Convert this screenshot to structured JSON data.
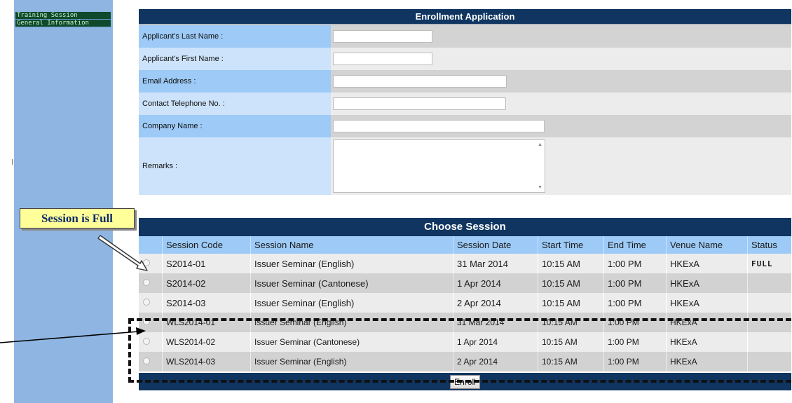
{
  "sidebar": {
    "items": [
      {
        "label": "Training Session"
      },
      {
        "label": "General Information"
      }
    ]
  },
  "form": {
    "title": "Enrollment Application",
    "fields": [
      {
        "label": "Applicant's Last Name :",
        "value": ""
      },
      {
        "label": "Applicant's First Name :",
        "value": ""
      },
      {
        "label": "Email Address :",
        "value": ""
      },
      {
        "label": "Contact Telephone No. :",
        "value": ""
      },
      {
        "label": "Company Name :",
        "value": ""
      },
      {
        "label": "Remarks :",
        "value": ""
      }
    ]
  },
  "session_table": {
    "title": "Choose Session",
    "headers": [
      "Session Code",
      "Session Name",
      "Session Date",
      "Start Time",
      "End Time",
      "Venue Name",
      "Status"
    ],
    "rows": [
      {
        "code": "S2014-01",
        "name": "Issuer Seminar (English)",
        "date": "31 Mar 2014",
        "start": "10:15 AM",
        "end": "1:00 PM",
        "venue": "HKExA",
        "status": "FULL"
      },
      {
        "code": "S2014-02",
        "name": "Issuer Seminar (Cantonese)",
        "date": "1 Apr 2014",
        "start": "10:15 AM",
        "end": "1:00 PM",
        "venue": "HKExA",
        "status": ""
      },
      {
        "code": "S2014-03",
        "name": "Issuer Seminar (English)",
        "date": "2 Apr 2014",
        "start": "10:15 AM",
        "end": "1:00 PM",
        "venue": "HKExA",
        "status": ""
      },
      {
        "code": "WLS2014-01",
        "name": "Issuer Seminar (English)",
        "date": "31 Mar 2014",
        "start": "10:15 AM",
        "end": "1:00 PM",
        "venue": "HKExA",
        "status": ""
      },
      {
        "code": "WLS2014-02",
        "name": "Issuer Seminar (Cantonese)",
        "date": "1 Apr 2014",
        "start": "10:15 AM",
        "end": "1:00 PM",
        "venue": "HKExA",
        "status": ""
      },
      {
        "code": "WLS2014-03",
        "name": "Issuer Seminar (English)",
        "date": "2 Apr 2014",
        "start": "10:15 AM",
        "end": "1:00 PM",
        "venue": "HKExA",
        "status": ""
      }
    ],
    "enroll_label": "Enroll"
  },
  "annotation": {
    "callout": "Session is Full"
  },
  "colors": {
    "header_bar": "#0f3560",
    "label_blue": "#9dcaf6",
    "label_light": "#cde3fb",
    "sidebar": "#8fb6e2",
    "sidebar_item": "#0f4a2c",
    "callout_bg": "#ffff99"
  }
}
